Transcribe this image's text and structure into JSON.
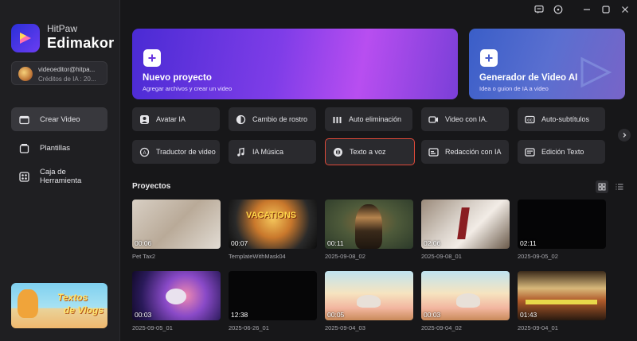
{
  "app": {
    "brand_top": "HitPaw",
    "brand_bottom": "Edimakor"
  },
  "account": {
    "email": "videoeditor@hitpa...",
    "credits": "Créditos de IA : 20..."
  },
  "sidebar": {
    "items": [
      {
        "label": "Crear Video",
        "icon": "video-plus-icon",
        "active": true
      },
      {
        "label": "Plantillas",
        "icon": "template-icon",
        "active": false
      },
      {
        "label": "Caja de Herramienta",
        "icon": "toolbox-icon",
        "active": false
      }
    ],
    "promo": {
      "line1": "Textos",
      "line2": "de Vlogs"
    }
  },
  "hero": {
    "new_project": {
      "title": "Nuevo proyecto",
      "subtitle": "Agregar archivos y crear un video"
    },
    "ai_generator": {
      "title": "Generador de Video AI",
      "subtitle": "Idea o guion de IA a video"
    }
  },
  "tools": [
    {
      "label": "Avatar IA",
      "icon": "avatar-icon"
    },
    {
      "label": "Cambio de rostro",
      "icon": "face-swap-icon"
    },
    {
      "label": "Auto eliminación",
      "icon": "auto-remove-icon"
    },
    {
      "label": "Video con IA.",
      "icon": "ai-video-icon"
    },
    {
      "label": "Auto-subtítulos",
      "icon": "subtitles-icon"
    },
    {
      "label": "Traductor de video",
      "icon": "translate-icon"
    },
    {
      "label": "IA Música",
      "icon": "music-icon"
    },
    {
      "label": "Texto a voz",
      "icon": "text-to-speech-icon",
      "selected": true
    },
    {
      "label": "Redacción con IA",
      "icon": "ai-writing-icon"
    },
    {
      "label": "Edición Texto",
      "icon": "text-edit-icon"
    }
  ],
  "projects": {
    "title": "Proyectos",
    "items": [
      {
        "name": "Pet Tax2",
        "duration": "00:06"
      },
      {
        "name": "TemplateWithMask04",
        "duration": "00:07"
      },
      {
        "name": "2025-09-08_02",
        "duration": "00:11"
      },
      {
        "name": "2025-09-08_01",
        "duration": "02:06"
      },
      {
        "name": "2025-09-05_02",
        "duration": "02:11"
      },
      {
        "name": "2025-09-05_01",
        "duration": "00:03"
      },
      {
        "name": "2025-06-26_01",
        "duration": "12:38"
      },
      {
        "name": "2025-09-04_03",
        "duration": "00:05"
      },
      {
        "name": "2025-09-04_02",
        "duration": "00:03"
      },
      {
        "name": "2025-09-04_01",
        "duration": "01:43"
      }
    ],
    "vacations_text": "VACATIONS"
  },
  "colors": {
    "accent_selected": "#e04a3a",
    "background": "#171719",
    "sidebar": "#1f1f22"
  }
}
